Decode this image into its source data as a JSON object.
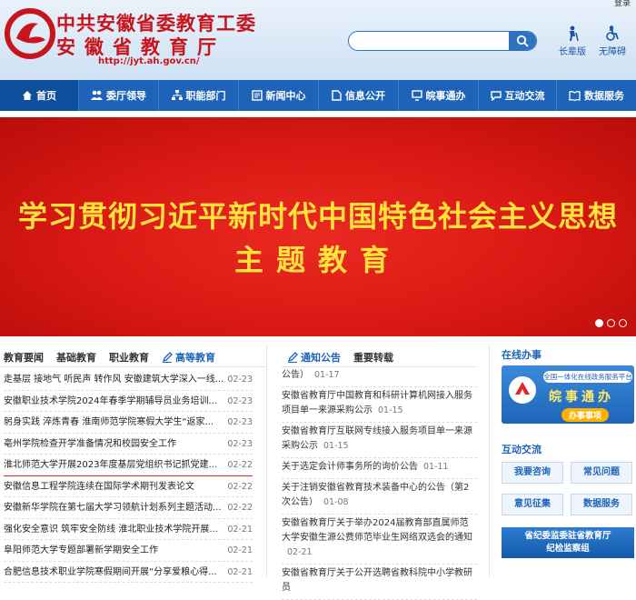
{
  "header": {
    "top_link": "登录",
    "title": "中共安徽省委教育工委",
    "subtitle": "安徽省教育厅",
    "url": "http://jyt.ah.gov.cn/",
    "search_placeholder": "",
    "elder_label": "长辈版",
    "access_label": "无障碍"
  },
  "nav": {
    "items": [
      "首页",
      "委厅领导",
      "职能部门",
      "新闻中心",
      "信息公开",
      "皖事通办",
      "互动交流",
      "数据服务"
    ]
  },
  "banner": {
    "line1": "学习贯彻习近平新时代中国特色社会主义思想",
    "line2": "主题教育"
  },
  "left": {
    "tabs": [
      "教育要闻",
      "基础教育",
      "职业教育",
      "高等教育"
    ],
    "items": [
      {
        "title": "走基层 接地气 听民声 转作风 安徽建筑大学深入一线...",
        "date": "02-23"
      },
      {
        "title": "安徽职业技术学院2024年春季学期辅导员业务培训...",
        "date": "02-23"
      },
      {
        "title": "躬身实践 淬炼青春 淮南师范学院寒假大学生“返家...",
        "date": "02-23"
      },
      {
        "title": "亳州学院检查开学准备情况和校园安全工作",
        "date": "02-23"
      },
      {
        "title": "淮北师范大学开展2023年度基层党组织书记抓党建...",
        "date": "02-22"
      },
      {
        "title": "安徽信息工程学院连续在国际学术期刊发表论文",
        "date": "02-22"
      },
      {
        "title": "安徽新华学院在第七届大学习领航计划系列主题活动...",
        "date": "02-22"
      },
      {
        "title": "强化安全意识 筑牢安全防线 淮北职业技术学院开展...",
        "date": "02-21"
      },
      {
        "title": "阜阳师范大学专题部署新学期安全工作",
        "date": "02-21"
      },
      {
        "title": "合肥信息技术职业学院寒假期间开展“分享爱粮心得...",
        "date": "02-21"
      }
    ]
  },
  "middle": {
    "tabs": [
      "通知公告",
      "重要转载"
    ],
    "items": [
      {
        "title": "公告）",
        "date": "01-17"
      },
      {
        "title": "安徽省教育厅中国教育和科研计算机网接入服务项目单一来源采购公示",
        "date": "01-15"
      },
      {
        "title": "安徽省教育厅互联网专线接入服务项目单一来源采购公示",
        "date": "01-15"
      },
      {
        "title": "关于选定会计师事务所的询价公告",
        "date": "01-11"
      },
      {
        "title": "关于注销安徽省教育技术装备中心的公告（第2次公告）",
        "date": "01-08"
      },
      {
        "title": "安徽省教育厅关于举办2024届教育部直属师范大学安徽生源公费师范毕业生网络双选会的通知",
        "date": "02-21"
      },
      {
        "title": "安徽省教育厅关于公开选聘省教科院中小学教研员",
        "date": ""
      }
    ]
  },
  "right": {
    "online_heading": "在线办事",
    "banner_top": "全国一体化在线政务服务平台",
    "banner_title": "皖事通办",
    "banner_button": "办事事项",
    "interact_heading": "互动交流",
    "buttons": [
      "我要咨询",
      "常见问题",
      "意见征集",
      "数据服务"
    ],
    "jjjc_line1": "省纪委监委驻省教育厅",
    "jjjc_line2": "纪检监察组"
  }
}
